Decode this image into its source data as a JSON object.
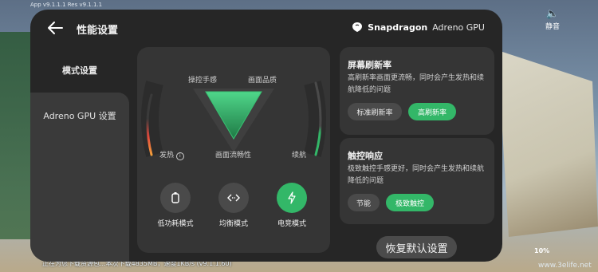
{
  "status": {
    "app_version": "App v9.1.1.1   Res v9.1.1.1",
    "mute_label": "静音",
    "download_text": "正在为您下载资源包...本次下载4835MB，速度1KB/s (v9.1.1.60)",
    "faint_text": "...",
    "percent": "10%",
    "watermark": "www.3elife.net"
  },
  "panel": {
    "title": "性能设置",
    "brand": {
      "name": "Snapdragon",
      "sub": "Adreno GPU"
    }
  },
  "sidebar": {
    "items": [
      {
        "label": "模式设置",
        "active": true
      },
      {
        "label": "Adreno GPU 设置",
        "active": false
      }
    ]
  },
  "mode_panel": {
    "gauge": {
      "top_left": "操控手感",
      "top_right": "画面品质",
      "bottom_center": "画面流畅性",
      "left": "发热",
      "right": "续航"
    },
    "modes": [
      {
        "label": "低功耗模式",
        "icon": "battery-icon",
        "active": false
      },
      {
        "label": "均衡模式",
        "icon": "balance-icon",
        "active": false
      },
      {
        "label": "电竞模式",
        "icon": "bolt-icon",
        "active": true
      }
    ]
  },
  "refresh": {
    "title": "屏幕刷新率",
    "desc": "高刷新率画面更流畅，同时会产生发热和续航降低的问题",
    "options": [
      "标准刷新率",
      "高刷新率"
    ],
    "selected": "高刷新率"
  },
  "touch": {
    "title": "触控响应",
    "desc": "极致触控手感更好，同时会产生发热和续航降低的问题",
    "options": [
      "节能",
      "极致触控"
    ],
    "selected": "极致触控"
  },
  "restore_label": "恢复默认设置",
  "colors": {
    "accent": "#33b768",
    "panel": "#262626",
    "card": "#353535"
  }
}
